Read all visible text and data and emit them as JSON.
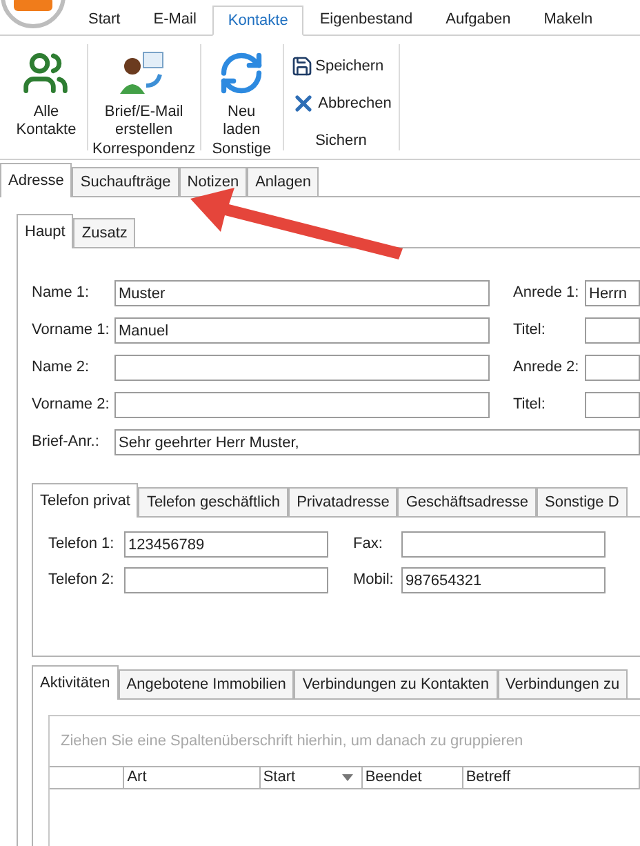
{
  "app_tabs": [
    {
      "label": "Start",
      "selected": false
    },
    {
      "label": "E-Mail",
      "selected": false
    },
    {
      "label": "Kontakte",
      "selected": true
    },
    {
      "label": "Eigenbestand",
      "selected": false
    },
    {
      "label": "Aufgaben",
      "selected": false
    },
    {
      "label": "Makeln",
      "selected": false
    }
  ],
  "ribbon_groups": [
    {
      "buttons": [
        {
          "lines": [
            "Alle",
            "Kontakte"
          ],
          "kind": "large"
        }
      ]
    },
    {
      "label": "Korrespondenz",
      "buttons": [
        {
          "lines": [
            "Brief/E-Mail",
            "erstellen"
          ],
          "kind": "large"
        }
      ]
    },
    {
      "label": "Sonstige",
      "buttons": [
        {
          "lines": [
            "Neu",
            "laden"
          ],
          "kind": "large"
        }
      ]
    },
    {
      "label": "Sichern",
      "buttons": [
        {
          "lines": [
            "Speichern"
          ],
          "kind": "small"
        },
        {
          "lines": [
            "Abbrechen"
          ],
          "kind": "small"
        }
      ]
    }
  ],
  "main_tabs": [
    {
      "label": "Adresse",
      "selected": true
    },
    {
      "label": "Suchaufträge",
      "selected": false
    },
    {
      "label": "Notizen",
      "selected": false
    },
    {
      "label": "Anlagen",
      "selected": false
    }
  ],
  "sub_tabs": [
    {
      "label": "Haupt",
      "selected": true
    },
    {
      "label": "Zusatz",
      "selected": false
    }
  ],
  "name_rows": [
    {
      "label": "Name 1:",
      "value": "Muster",
      "right_label": "Anrede 1:",
      "right_value": "Herrn"
    },
    {
      "label": "Vorname 1:",
      "value": "Manuel",
      "right_label": "Titel:"
    },
    {
      "label": "Name 2:",
      "right_label": "Anrede 2:"
    },
    {
      "label": "Vorname 2:",
      "right_label": "Titel:"
    }
  ],
  "salutation": {
    "label": "Brief-Anr.:",
    "value": "Sehr geehrter Herr Muster,"
  },
  "contact_tabs": [
    {
      "label": "Telefon privat",
      "selected": true
    },
    {
      "label": "Telefon geschäftlich",
      "selected": false
    },
    {
      "label": "Privatadresse",
      "selected": false
    },
    {
      "label": "Geschäftsadresse",
      "selected": false
    },
    {
      "label": "Sonstige D",
      "selected": false
    }
  ],
  "phone_rows": [
    {
      "label": "Telefon 1:",
      "value": "123456789",
      "right_label": "Fax:"
    },
    {
      "label": "Telefon 2:",
      "right_label": "Mobil:",
      "right_value": "987654321"
    }
  ],
  "activity_tabs": [
    {
      "label": "Aktivitäten",
      "selected": true
    },
    {
      "label": "Angebotene Immobilien",
      "selected": false
    },
    {
      "label": "Verbindungen zu Kontakten",
      "selected": false
    },
    {
      "label": "Verbindungen zu",
      "selected": false
    }
  ],
  "grid": {
    "group_hint": "Ziehen Sie eine Spaltenüberschrift hierhin, um danach zu gruppieren",
    "columns": [
      {
        "label": "Art",
        "sorted": false
      },
      {
        "label": "Start",
        "sorted": true
      },
      {
        "label": "Beendet",
        "sorted": false
      },
      {
        "label": "Betreff",
        "sorted": false
      }
    ]
  }
}
